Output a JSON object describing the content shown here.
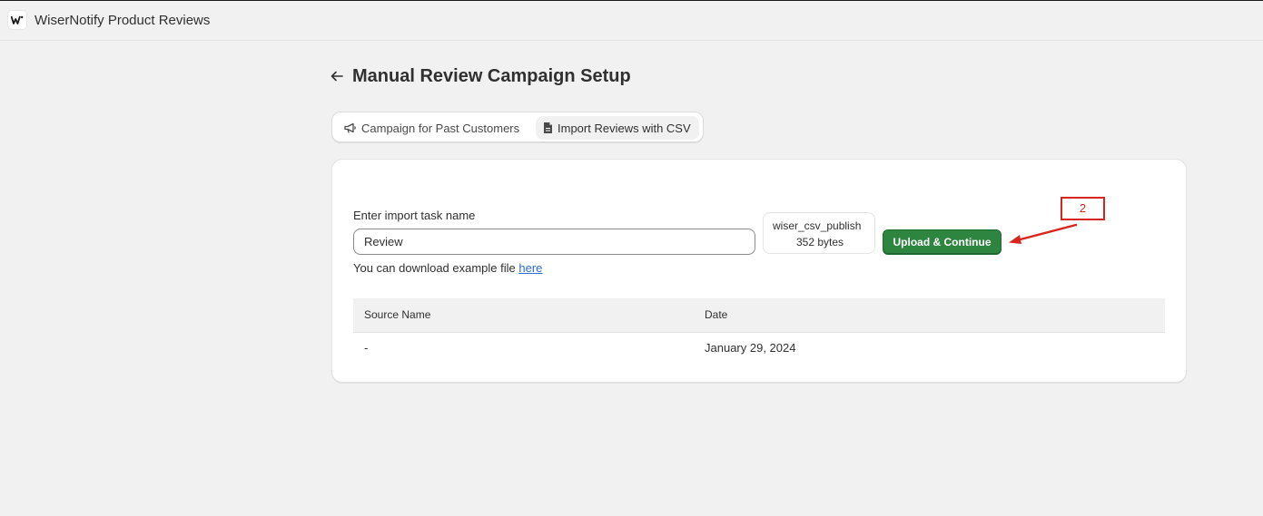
{
  "app": {
    "title": "WiserNotify Product Reviews",
    "logo_icon": "wisernotify-logo-icon"
  },
  "page": {
    "title": "Manual Review Campaign Setup",
    "back_icon": "arrow-left-icon"
  },
  "tabs": [
    {
      "label": "Campaign for Past Customers",
      "icon": "megaphone-icon",
      "selected": false
    },
    {
      "label": "Import Reviews with CSV",
      "icon": "file-icon",
      "selected": true
    }
  ],
  "form": {
    "task_name_label": "Enter import task name",
    "task_name_value": "Review",
    "file_name": "wiser_csv_publish",
    "file_size": "352 bytes",
    "upload_label": "Upload & Continue",
    "download_prefix": "You can download example file ",
    "download_link": "here"
  },
  "table": {
    "columns": [
      "Source Name",
      "Date"
    ],
    "rows": [
      {
        "source": "-",
        "date": "January 29, 2024"
      }
    ]
  },
  "annotation": {
    "label": "2",
    "color": "#d9261c"
  },
  "colors": {
    "primary_button": "#2e8540",
    "link": "#2c6ecb",
    "background": "#f1f1f1"
  }
}
